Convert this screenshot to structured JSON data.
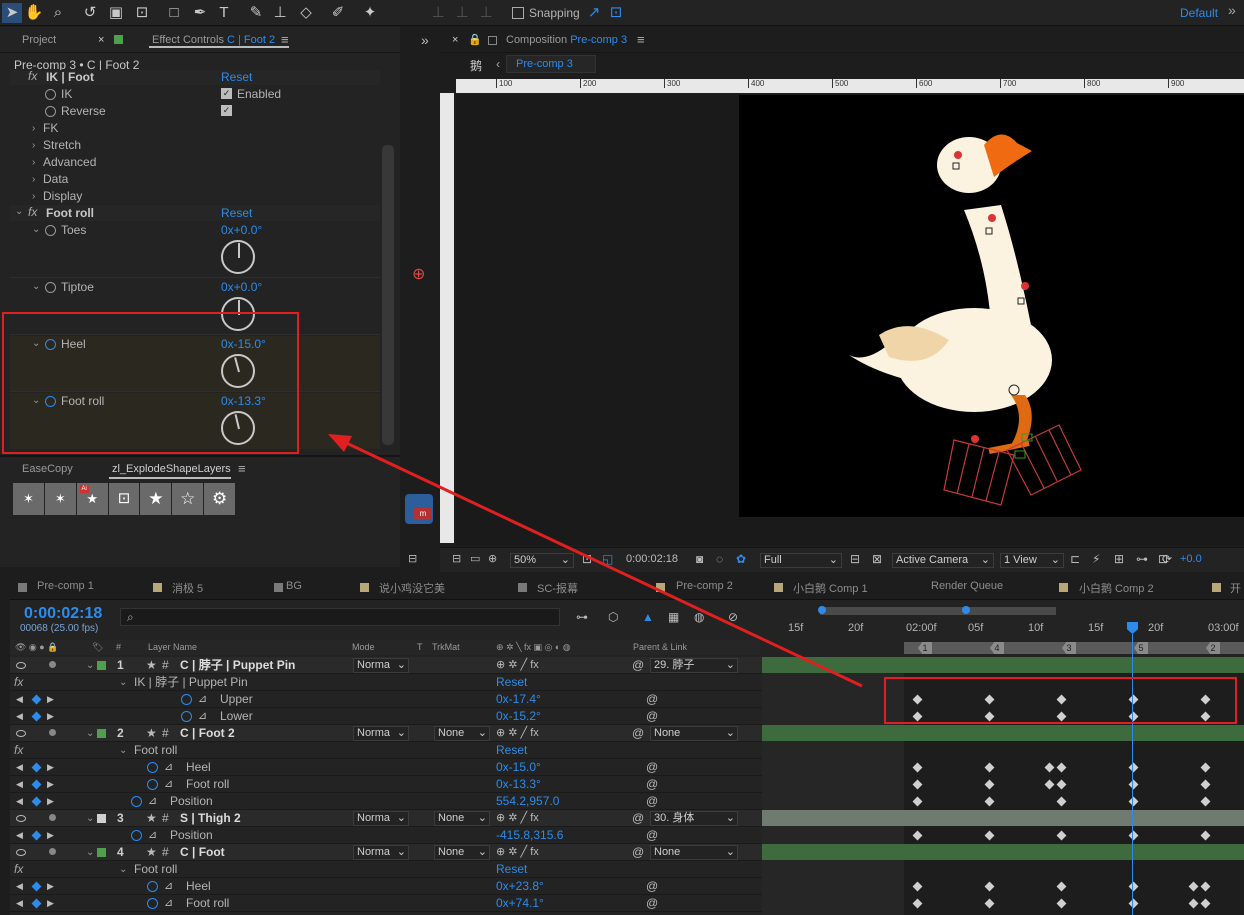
{
  "toolbar": {
    "snapping": "Snapping",
    "workspace": "Default"
  },
  "left_panel": {
    "tab_project": "Project",
    "tab_effect_prefix": "Effect Controls",
    "tab_effect_layer": "C | Foot 2",
    "breadcrumb": "Pre-comp 3 • C | Foot 2",
    "ik_header": "IK | Foot",
    "reset": "Reset",
    "ik_label": "IK",
    "enabled": "Enabled",
    "reverse": "Reverse",
    "groups": [
      "FK",
      "Stretch",
      "Advanced",
      "Data",
      "Display"
    ],
    "footroll_header": "Foot roll",
    "props": [
      {
        "label": "Toes",
        "value": "0x+0.0°",
        "angle": 0
      },
      {
        "label": "Tiptoe",
        "value": "0x+0.0°",
        "angle": 0
      },
      {
        "label": "Heel",
        "value": "0x-15.0°",
        "angle": -15
      },
      {
        "label": "Foot roll",
        "value": "0x-13.3°",
        "angle": -13.3
      }
    ],
    "tab_easecopy": "EaseCopy",
    "tab_explode": "zl_ExplodeShapeLayers"
  },
  "comp_panel": {
    "title_prefix": "Composition",
    "title_name": "Pre-comp 3",
    "crumb_char": "鹅",
    "crumb_tab": "Pre-comp 3",
    "ruler": [
      "100",
      "200",
      "300",
      "400",
      "500",
      "600",
      "700",
      "800",
      "900"
    ],
    "zoom": "50%",
    "timecode": "0:00:02:18",
    "resolution": "Full",
    "camera": "Active Camera",
    "views": "1 View",
    "exposure": "+0.0"
  },
  "timeline": {
    "tabs": [
      "Pre-comp 1",
      "消极 5",
      "BG",
      "说小鸡没它美",
      "SC-报幕",
      "Pre-comp 2",
      "小白鹅 Comp 1",
      "Render Queue",
      "小白鹅 Comp 2",
      "开"
    ],
    "timecode": "0:00:02:18",
    "frames": "00068 (25.00 fps)",
    "col_layer": "Layer Name",
    "col_mode": "Mode",
    "col_t": "T",
    "col_trkmat": "TrkMat",
    "col_parent": "Parent & Link",
    "ticks": [
      "15f",
      "20f",
      "02:00f",
      "05f",
      "10f",
      "15f",
      "20f",
      "03:00f"
    ],
    "markers": [
      "1",
      "4",
      "3",
      "5",
      "2"
    ],
    "layers": {
      "l1": {
        "num": "1",
        "name": "C | 脖子 | Puppet Pin",
        "mode": "Norma",
        "parent": "29. 脖子"
      },
      "l1_effect": "IK | 脖子 | Puppet Pin",
      "l1_reset": "Reset",
      "l1_upper": "Upper",
      "l1_upper_val": "0x-17.4°",
      "l1_lower": "Lower",
      "l1_lower_val": "0x-15.2°",
      "l2": {
        "num": "2",
        "name": "C | Foot 2",
        "mode": "Norma",
        "trkmat": "None",
        "parent": "None"
      },
      "l2_effect": "Foot roll",
      "l2_reset": "Reset",
      "l2_heel": "Heel",
      "l2_heel_val": "0x-15.0°",
      "l2_footroll": "Foot roll",
      "l2_footroll_val": "0x-13.3°",
      "l2_position": "Position",
      "l2_position_val": "554.2,957.0",
      "l3": {
        "num": "3",
        "name": "S | Thigh 2",
        "mode": "Norma",
        "trkmat": "None",
        "parent": "30. 身体"
      },
      "l3_position": "Position",
      "l3_position_val": "-415.8,315.6",
      "l4": {
        "num": "4",
        "name": "C | Foot",
        "mode": "Norma",
        "trkmat": "None",
        "parent": "None"
      },
      "l4_effect": "Foot roll",
      "l4_reset": "Reset",
      "l4_heel": "Heel",
      "l4_heel_val": "0x+23.8°",
      "l4_footroll": "Foot roll",
      "l4_footroll_val": "0x+74.1°"
    }
  },
  "colors": {
    "accent": "#2d8ceb",
    "highlight": "#e02020",
    "layer_green": "#3e6b3d"
  }
}
